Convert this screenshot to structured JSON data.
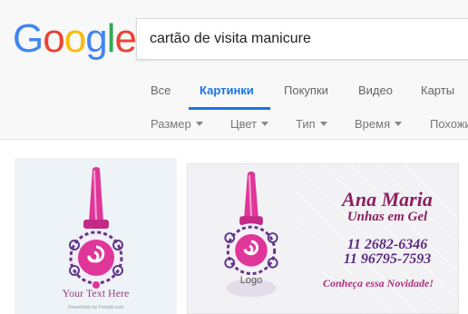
{
  "logo": {
    "text": "Google",
    "letters": [
      "G",
      "o",
      "o",
      "g",
      "l",
      "e"
    ],
    "colors": [
      "#4285f4",
      "#ea4335",
      "#fbbc05",
      "#4285f4",
      "#34a853",
      "#ea4335"
    ]
  },
  "search": {
    "query": "cartão de visita manicure"
  },
  "tabs": [
    {
      "label": "Все"
    },
    {
      "label": "Картинки",
      "active": true
    },
    {
      "label": "Покупки"
    },
    {
      "label": "Видео"
    },
    {
      "label": "Карты"
    }
  ],
  "filters": [
    {
      "label": "Размер"
    },
    {
      "label": "Цвет"
    },
    {
      "label": "Тип"
    },
    {
      "label": "Время"
    },
    {
      "label": "Похожие"
    }
  ],
  "results": {
    "card1": {
      "text": "Your Text Here",
      "source": "Desenhado by Freepik.com"
    },
    "card2": {
      "logo_label": "Logo",
      "name": "Ana Maria",
      "subtitle": "Unhas em Gel",
      "phone1": "11 2682-6346",
      "phone2": "11 96795-7593",
      "tagline": "Conheça essa Novidade!"
    }
  },
  "colors": {
    "accent": "#1a73e8",
    "polish_pink": "#e0369a",
    "swirl_purple": "#5d3a8a"
  }
}
